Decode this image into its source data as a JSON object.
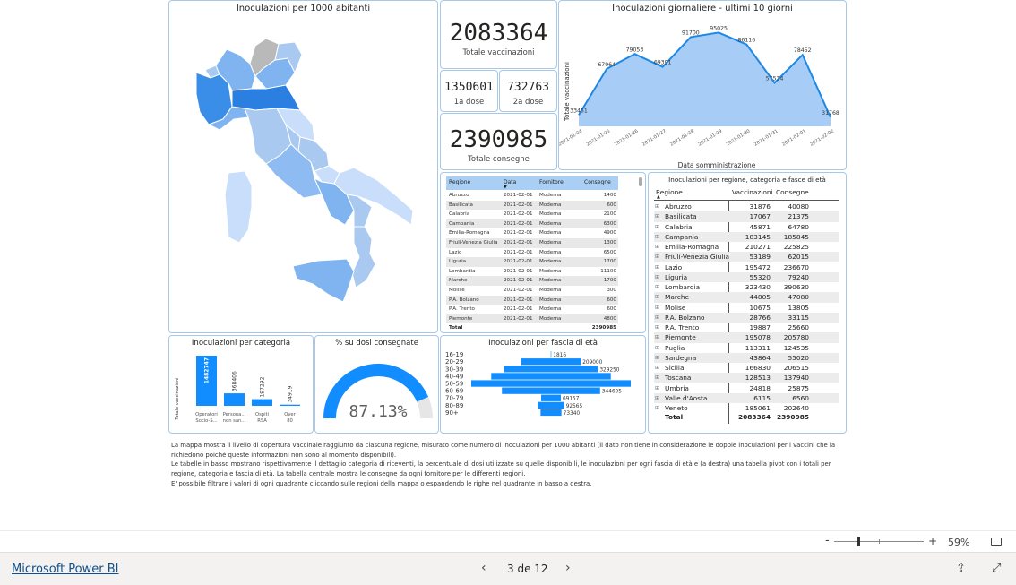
{
  "map": {
    "title": "Inoculazioni per 1000 abitanti"
  },
  "kpi": {
    "total_vacc": "2083364",
    "total_vacc_label": "Totale vaccinazioni",
    "dose1": "1350601",
    "dose1_label": "1a dose",
    "dose2": "732763",
    "dose2_label": "2a dose",
    "total_cons": "2390985",
    "total_cons_label": "Totale consegne"
  },
  "line": {
    "title": "Inoculazioni giornaliere - ultimi 10 giorni",
    "ylabel": "Totale vaccinazioni",
    "xlabel": "Data somministrazione"
  },
  "chart_data": [
    {
      "type": "area",
      "title": "Inoculazioni giornaliere - ultimi 10 giorni",
      "xlabel": "Data somministrazione",
      "ylabel": "Totale vaccinazioni",
      "x": [
        "2021-01-24",
        "2021-01-25",
        "2021-01-26",
        "2021-01-27",
        "2021-01-28",
        "2021-01-29",
        "2021-01-30",
        "2021-01-31",
        "2021-02-01",
        "2021-02-02"
      ],
      "values": [
        33451,
        67964,
        79053,
        69391,
        91700,
        95025,
        86116,
        57534,
        78452,
        31768
      ],
      "data_labels": [
        "33451",
        "67964",
        "79053",
        "69391",
        "91700",
        "95025",
        "86116",
        "57534",
        "78452",
        "31768"
      ],
      "color": "#1e88e5"
    },
    {
      "type": "bar",
      "title": "Inoculazioni per categoria",
      "ylabel": "Totale vaccinazioni",
      "categories": [
        "Operatori Socio-S...",
        "Persona... non san...",
        "Ospiti RSA",
        "Over 80"
      ],
      "values": [
        1482747,
        368406,
        197292,
        34919
      ],
      "data_labels": [
        "1482747",
        "368406",
        "197292",
        "34919"
      ],
      "color": "#118dff"
    },
    {
      "type": "gauge",
      "title": "% su dosi consegnate",
      "value": 87.13,
      "label": "87.13%",
      "color": "#118dff"
    },
    {
      "type": "bar",
      "orientation": "horizontal-centered",
      "title": "Inoculazioni per fascia di età",
      "categories": [
        "16-19",
        "20-29",
        "30-39",
        "40-49",
        "50-59",
        "60-69",
        "70-79",
        "80-89",
        "90+"
      ],
      "values": [
        1816,
        209000,
        329250,
        420000,
        560000,
        344695,
        69157,
        92565,
        73340
      ],
      "data_labels": [
        "1816",
        "209000",
        "329250",
        "",
        "",
        "344695",
        "69157",
        "92565",
        "73340"
      ],
      "color": "#118dff"
    }
  ],
  "table": {
    "headers": [
      "Regione",
      "Data",
      "Fornitore",
      "Consegne"
    ],
    "rows": [
      [
        "Abruzzo",
        "2021-02-01",
        "Moderna",
        "1400"
      ],
      [
        "Basilicata",
        "2021-02-01",
        "Moderna",
        "600"
      ],
      [
        "Calabria",
        "2021-02-01",
        "Moderna",
        "2100"
      ],
      [
        "Campania",
        "2021-02-01",
        "Moderna",
        "6300"
      ],
      [
        "Emilia-Romagna",
        "2021-02-01",
        "Moderna",
        "4900"
      ],
      [
        "Friuli-Venezia Giulia",
        "2021-02-01",
        "Moderna",
        "1300"
      ],
      [
        "Lazio",
        "2021-02-01",
        "Moderna",
        "6500"
      ],
      [
        "Liguria",
        "2021-02-01",
        "Moderna",
        "1700"
      ],
      [
        "Lombardia",
        "2021-02-01",
        "Moderna",
        "11100"
      ],
      [
        "Marche",
        "2021-02-01",
        "Moderna",
        "1700"
      ],
      [
        "Molise",
        "2021-02-01",
        "Moderna",
        "300"
      ],
      [
        "P.A. Bolzano",
        "2021-02-01",
        "Moderna",
        "600"
      ],
      [
        "P.A. Trento",
        "2021-02-01",
        "Moderna",
        "600"
      ],
      [
        "Piemonte",
        "2021-02-01",
        "Moderna",
        "4800"
      ]
    ],
    "total_label": "Total",
    "total_value": "2390985"
  },
  "pivot": {
    "title": "Inoculazioni per regione, categoria e fasce di età",
    "headers": [
      "Regione",
      "Vaccinazioni",
      "Consegne"
    ],
    "rows": [
      [
        "Abruzzo",
        "31876",
        "40080"
      ],
      [
        "Basilicata",
        "17067",
        "21375"
      ],
      [
        "Calabria",
        "45871",
        "64780"
      ],
      [
        "Campania",
        "183145",
        "185845"
      ],
      [
        "Emilia-Romagna",
        "210271",
        "225825"
      ],
      [
        "Friuli-Venezia Giulia",
        "53189",
        "62015"
      ],
      [
        "Lazio",
        "195472",
        "236670"
      ],
      [
        "Liguria",
        "55320",
        "79240"
      ],
      [
        "Lombardia",
        "323430",
        "390630"
      ],
      [
        "Marche",
        "44805",
        "47080"
      ],
      [
        "Molise",
        "10675",
        "13805"
      ],
      [
        "P.A. Bolzano",
        "28766",
        "33115"
      ],
      [
        "P.A. Trento",
        "19887",
        "25660"
      ],
      [
        "Piemonte",
        "195078",
        "205780"
      ],
      [
        "Puglia",
        "113311",
        "124535"
      ],
      [
        "Sardegna",
        "43864",
        "55020"
      ],
      [
        "Sicilia",
        "166830",
        "206515"
      ],
      [
        "Toscana",
        "128513",
        "137940"
      ],
      [
        "Umbria",
        "24818",
        "25875"
      ],
      [
        "Valle d'Aosta",
        "6115",
        "6560"
      ],
      [
        "Veneto",
        "185061",
        "202640"
      ]
    ],
    "total_label": "Total",
    "total_vacc": "2083364",
    "total_cons": "2390985"
  },
  "notes": [
    "La mappa mostra il livello di copertura vaccinale raggiunto da ciascuna regione, misurato come numero di inoculazioni per 1000 abitanti (il dato non tiene in considerazione le doppie inoculazioni per i vaccini che la richiedono poiché queste informazioni non sono al momento disponibili).",
    "Le tabelle in basso mostrano rispettivamente il dettaglio categoria di riceventi, la percentuale di dosi utilizzate su quelle disponibili, le inoculazioni per ogni fascia di età e (a destra) una tabella pivot con i totali per regione, categoria e fascia di età. La tabella centrale mostra le consegne da ogni fornitore per le differenti regioni.",
    "E' possibile filtrare i valori di ogni quadrante cliccando sulle regioni della mappa o espandendo le righe nel quadrante in basso a destra."
  ],
  "footer": {
    "brand": "Microsoft Power BI",
    "page": "3 de 12",
    "zoom": "59%"
  },
  "icons": [
    "chevron-left-icon",
    "chevron-right-icon",
    "share-icon",
    "fullscreen-icon",
    "fit-page-icon",
    "zoom-minus-icon",
    "zoom-plus-icon"
  ]
}
